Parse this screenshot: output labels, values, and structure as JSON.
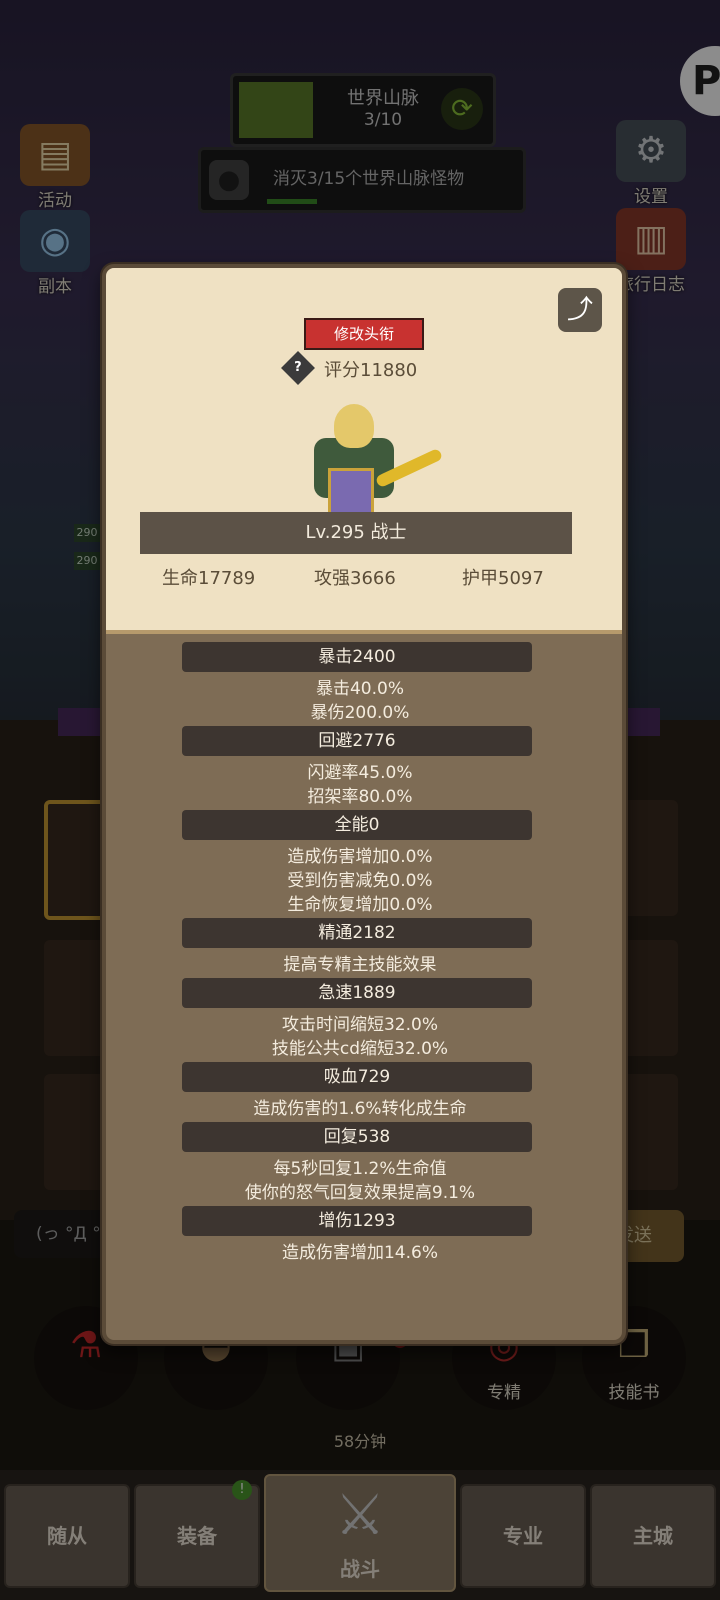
{
  "quest": {
    "title": "世界山脉",
    "progress": "3/10",
    "mission": "消灭3/15个世界山脉怪物"
  },
  "side_left": [
    {
      "label": "活动",
      "icon": "scroll-icon"
    },
    {
      "label": "副本",
      "icon": "portal-icon"
    }
  ],
  "side_right": [
    {
      "label": "设置",
      "icon": "gear-icon"
    },
    {
      "label": "旅行日志",
      "icon": "book-icon"
    }
  ],
  "corner_badge": "P",
  "bg_levels": [
    "290",
    "290"
  ],
  "chat": {
    "placeholder": "(っ °Д °",
    "send": "发送"
  },
  "round_buttons": [
    {
      "label": "",
      "icon": "potion-icon"
    },
    {
      "label": "",
      "icon": "bread-icon"
    },
    {
      "label": "",
      "icon": "chest-icon"
    },
    {
      "label": "专精",
      "icon": "target-icon"
    },
    {
      "label": "技能书",
      "icon": "skillbook-icon"
    }
  ],
  "chest_timer": "58分钟",
  "chest_badge": "!",
  "nav": {
    "tabs": [
      "随从",
      "装备",
      "战斗",
      "专业",
      "主城"
    ],
    "active": "战斗",
    "badge": "!"
  },
  "profile": {
    "title_button": "修改头衔",
    "score_label": "评分11880",
    "level_class": "Lv.295 战士",
    "base_stats": {
      "hp": "生命17789",
      "atk": "攻强3666",
      "armor": "护甲5097"
    }
  },
  "stats": [
    {
      "header": "暴击2400",
      "details": [
        "暴击40.0%",
        "暴伤200.0%"
      ]
    },
    {
      "header": "回避2776",
      "details": [
        "闪避率45.0%",
        "招架率80.0%"
      ]
    },
    {
      "header": "全能0",
      "details": [
        "造成伤害增加0.0%",
        "受到伤害减免0.0%",
        "生命恢复增加0.0%"
      ]
    },
    {
      "header": "精通2182",
      "details": [
        "提高专精主技能效果"
      ]
    },
    {
      "header": "急速1889",
      "details": [
        "攻击时间缩短32.0%",
        "技能公共cd缩短32.0%"
      ]
    },
    {
      "header": "吸血729",
      "details": [
        "造成伤害的1.6%转化成生命"
      ]
    },
    {
      "header": "回复538",
      "details": [
        "每5秒回复1.2%生命值",
        "使你的怒气回复效果提高9.1%"
      ]
    },
    {
      "header": "增伤1293",
      "details": [
        "造成伤害增加14.6%"
      ]
    }
  ]
}
